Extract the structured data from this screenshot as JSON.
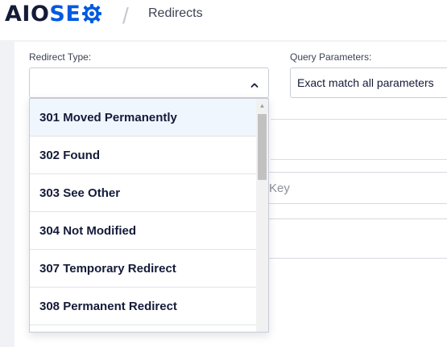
{
  "header": {
    "logo_aio": "AIO",
    "logo_se": "SE",
    "separator": "/",
    "breadcrumb": "Redirects"
  },
  "form": {
    "redirect_type_label": "Redirect Type:",
    "query_params_label": "Query Parameters:",
    "query_params_value": "Exact match all parameters",
    "key_placeholder": "Key"
  },
  "dropdown": {
    "options": [
      {
        "label": "301 Moved Permanently",
        "active": true
      },
      {
        "label": "302 Found"
      },
      {
        "label": "303 See Other"
      },
      {
        "label": "304 Not Modified"
      },
      {
        "label": "307 Temporary Redirect"
      },
      {
        "label": "308 Permanent Redirect"
      }
    ]
  },
  "colors": {
    "brand_dark": "#141b38",
    "brand_blue": "#005ae0",
    "active_option_bg": "#f0f6fe"
  }
}
